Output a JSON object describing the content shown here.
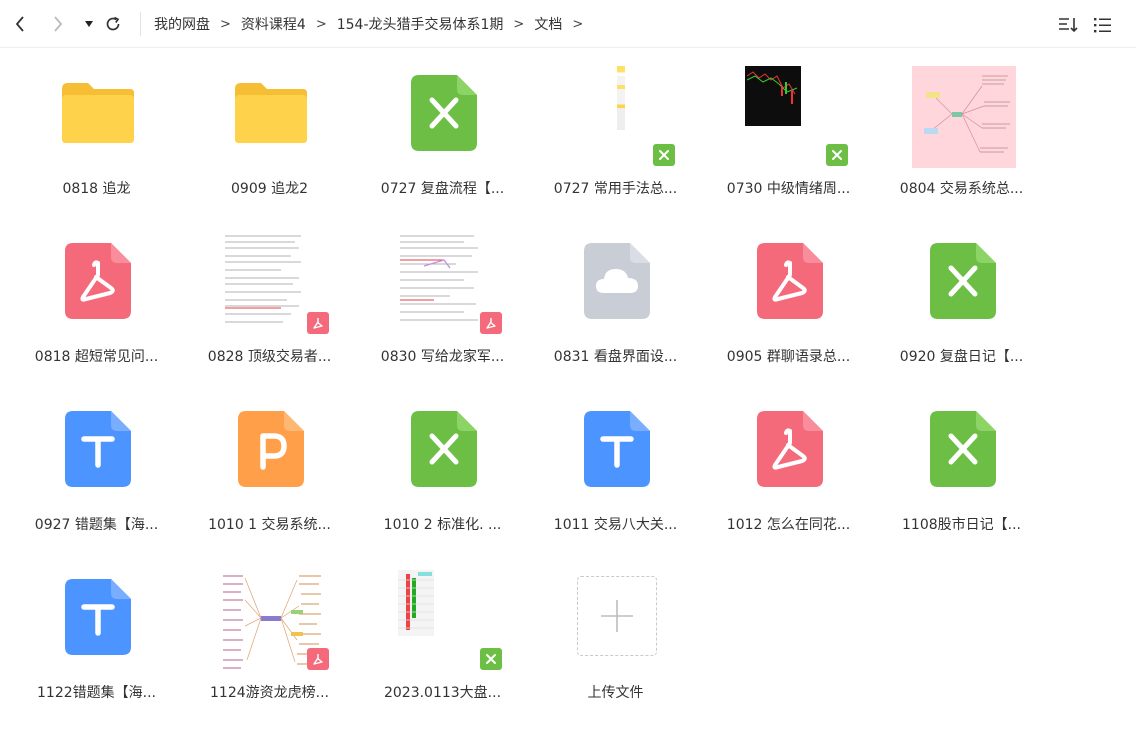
{
  "toolbar": {
    "breadcrumb": [
      "我的网盘",
      "资料课程4",
      "154-龙头猎手交易体系1期",
      "文档"
    ],
    "separator": ">"
  },
  "colors": {
    "folder": "#FFD24C",
    "folder_tab": "#F5BE34",
    "excel": "#6CBE45",
    "pdf": "#F46A7B",
    "word": "#4C94FF",
    "ppt": "#FF9F4A",
    "cloud": "#C9CDD6",
    "upload_border": "#C9C9C9"
  },
  "files": [
    {
      "name": "0818 追龙",
      "type": "folder-icon"
    },
    {
      "name": "0909 追龙2",
      "type": "folder-icon"
    },
    {
      "name": "0727 复盘流程【...",
      "type": "excel-icon"
    },
    {
      "name": "0727 常用手法总...",
      "type": "excel-thumbnail"
    },
    {
      "name": "0730 中级情绪周...",
      "type": "excel-thumbnail"
    },
    {
      "name": "0804 交易系统总...",
      "type": "image-thumbnail"
    },
    {
      "name": "0818 超短常见问...",
      "type": "pdf-icon"
    },
    {
      "name": "0828 顶级交易者...",
      "type": "pdf-thumbnail"
    },
    {
      "name": "0830 写给龙家军...",
      "type": "pdf-thumbnail"
    },
    {
      "name": "0831 看盘界面设...",
      "type": "cloud-icon"
    },
    {
      "name": "0905 群聊语录总...",
      "type": "pdf-icon"
    },
    {
      "name": "0920 复盘日记【...",
      "type": "excel-icon"
    },
    {
      "name": "0927 错题集【海...",
      "type": "word-icon"
    },
    {
      "name": "1010 1 交易系统...",
      "type": "ppt-icon"
    },
    {
      "name": "1010 2 标准化. ...",
      "type": "excel-icon"
    },
    {
      "name": "1011 交易八大关...",
      "type": "word-icon"
    },
    {
      "name": "1012 怎么在同花...",
      "type": "pdf-icon"
    },
    {
      "name": "1108股市日记【...",
      "type": "excel-icon"
    },
    {
      "name": "1122错题集【海...",
      "type": "word-icon"
    },
    {
      "name": "1124游资龙虎榜...",
      "type": "pdf-thumbnail"
    },
    {
      "name": "2023.0113大盘...",
      "type": "excel-thumbnail"
    }
  ],
  "upload": {
    "label": "上传文件"
  }
}
